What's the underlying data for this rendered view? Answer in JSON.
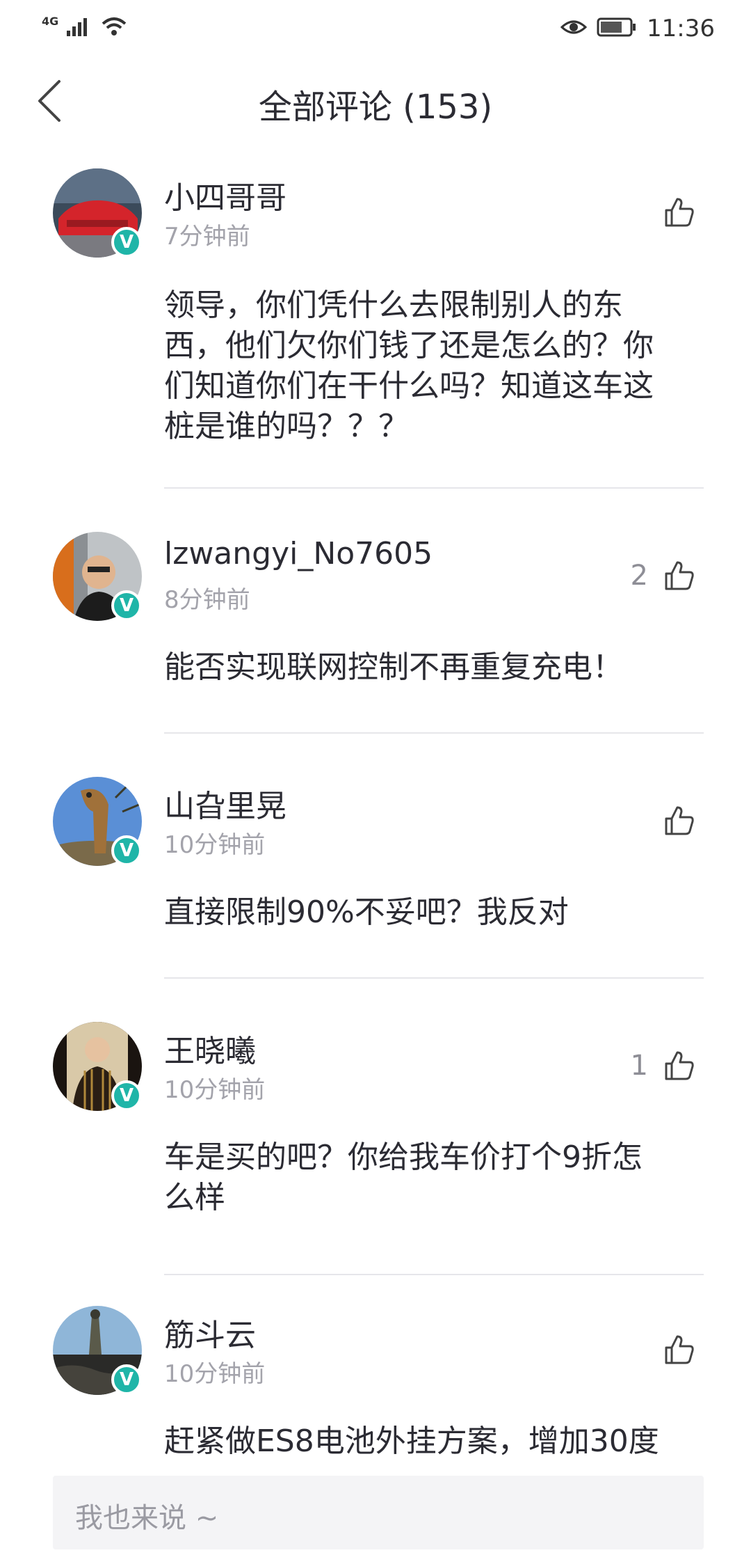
{
  "status_bar": {
    "network": "4G",
    "time": "11:36"
  },
  "header": {
    "title": "全部评论 (153)"
  },
  "comments": [
    {
      "username": "小四哥哥",
      "time": "7分钟前",
      "likes": "",
      "lines": [
        "领导，你们凭什么去限制别人的东",
        "西，他们欠你们钱了还是怎么的？你",
        "们知道你们在干什么吗？知道这车这",
        "桩是谁的吗？？？"
      ]
    },
    {
      "username": "lzwangyi_No7605",
      "time": "8分钟前",
      "likes": "2",
      "lines": [
        "能否实现联网控制不再重复充电！"
      ]
    },
    {
      "username": "山旮里晃",
      "time": "10分钟前",
      "likes": "",
      "lines": [
        "直接限制90%不妥吧？我反对"
      ]
    },
    {
      "username": "王晓曦",
      "time": "10分钟前",
      "likes": "1",
      "lines": [
        "车是买的吧？你给我车价打个9折怎",
        "么样"
      ]
    },
    {
      "username": "筋斗云",
      "time": "10分钟前",
      "likes": "",
      "lines": [
        "赶紧做ES8电池外挂方案，增加30度"
      ]
    }
  ],
  "verified_badge": "V",
  "input": {
    "placeholder": "我也来说 ~"
  },
  "colors": {
    "accent": "#1fb5a8",
    "text": "#2b2b33",
    "muted": "#a3a3ab",
    "divider": "#e6e6ea"
  }
}
